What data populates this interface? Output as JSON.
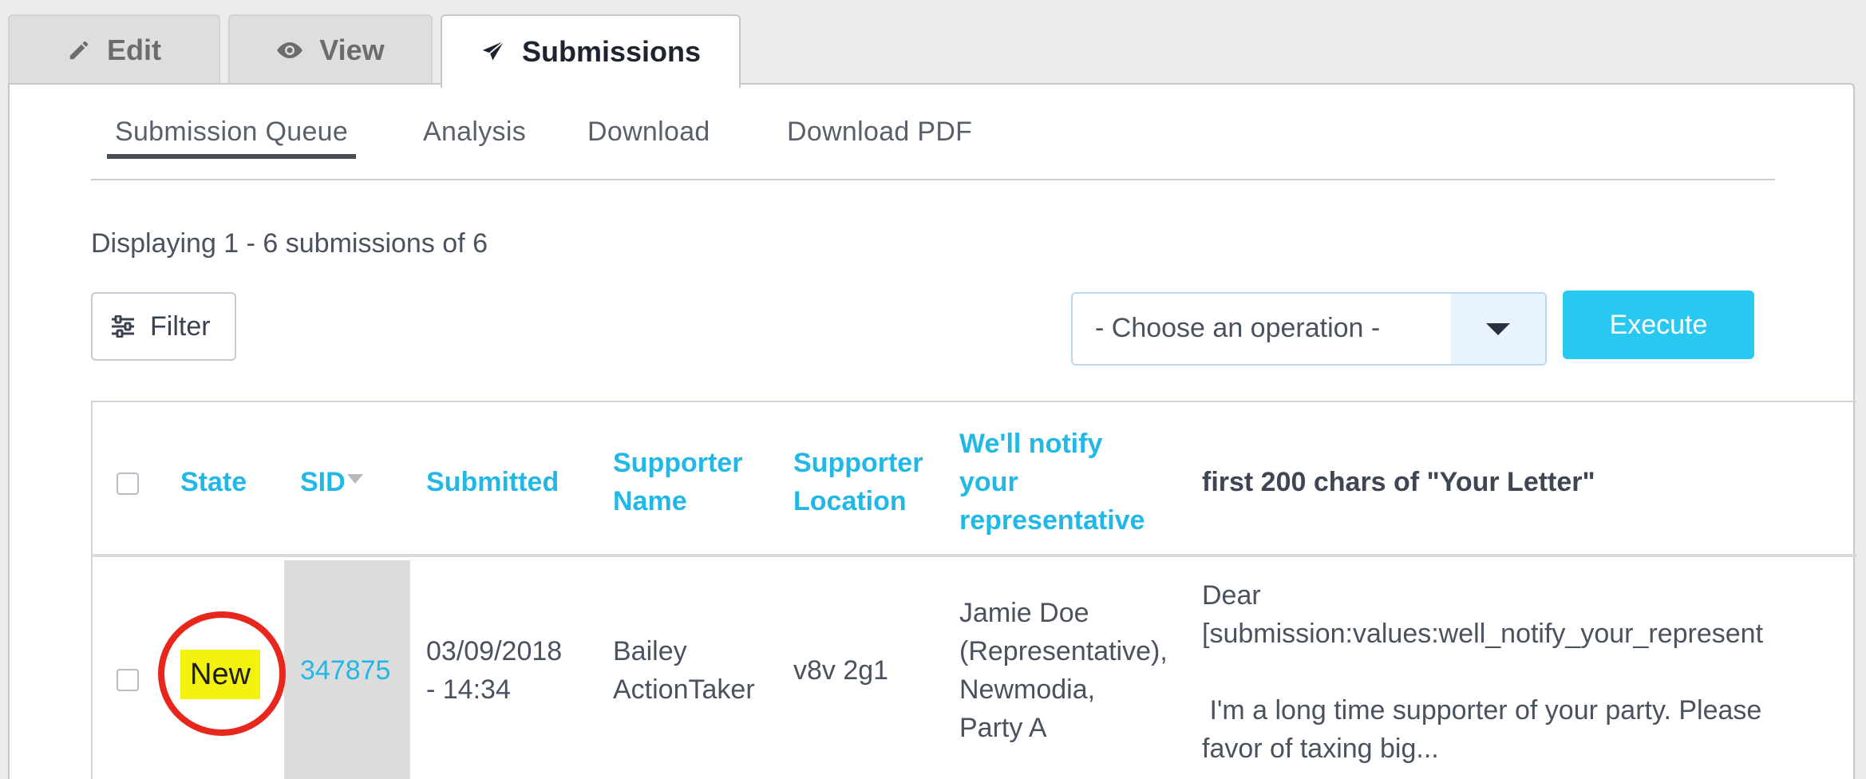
{
  "tabs": [
    {
      "label": "Edit",
      "icon": "pencil-icon"
    },
    {
      "label": "View",
      "icon": "eye-icon"
    },
    {
      "label": "Submissions",
      "icon": "paper-plane-icon",
      "active": true
    }
  ],
  "subtabs": [
    {
      "label": "Submission Queue",
      "active": true
    },
    {
      "label": "Analysis"
    },
    {
      "label": "Download"
    },
    {
      "label": "Download PDF"
    }
  ],
  "summary": "Displaying 1 - 6 submissions of 6",
  "filter_button": {
    "label": "Filter",
    "icon": "sliders-icon"
  },
  "operation_select": {
    "value": "- Choose an operation -",
    "icon": "caret-down-icon"
  },
  "execute_button": {
    "label": "Execute"
  },
  "table": {
    "headers": {
      "state": "State",
      "sid": "SID",
      "submitted": "Submitted",
      "supporter_name_1": "Supporter",
      "supporter_name_2": "Name",
      "supporter_location_1": "Supporter",
      "supporter_location_2": "Location",
      "notify_1": "We'll notify",
      "notify_2": "your",
      "notify_3": "representative",
      "letter": "first 200 chars of \"Your Letter\""
    },
    "rows": [
      {
        "state": "New",
        "sid": "347875",
        "submitted_1": "03/09/2018",
        "submitted_2": "- 14:34",
        "name_1": "Bailey",
        "name_2": "ActionTaker",
        "location": "v8v 2g1",
        "notify_1": "Jamie Doe",
        "notify_2": "(Representative),",
        "notify_3": "Newmodia,",
        "notify_4": "Party A",
        "letter_1": "Dear",
        "letter_2": "[submission:values:well_notify_your_represent",
        "letter_3": " I'm a long time supporter of your party. Please",
        "letter_4": "favor of taxing big..."
      }
    ]
  },
  "colors": {
    "accent": "#22b8e6",
    "execute_bg": "#29c8f0",
    "badge": "#f3f20e",
    "highlight_circle": "#e8261c"
  }
}
